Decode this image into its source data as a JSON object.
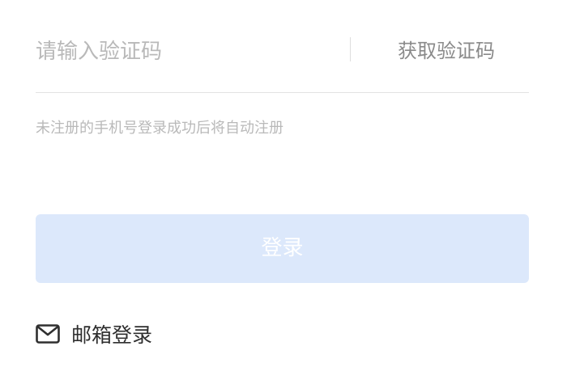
{
  "verification": {
    "code_placeholder": "请输入验证码",
    "code_value": "",
    "get_code_label": "获取验证码"
  },
  "hint_text": "未注册的手机号登录成功后将自动注册",
  "login_button_label": "登录",
  "email_login": {
    "label": "邮箱登录",
    "icon": "mail-icon"
  },
  "colors": {
    "placeholder": "#b9b9b9",
    "login_button_bg": "#dce8fb",
    "get_code_text": "#8a8a8a",
    "divider_line": "#e2e2e2"
  }
}
